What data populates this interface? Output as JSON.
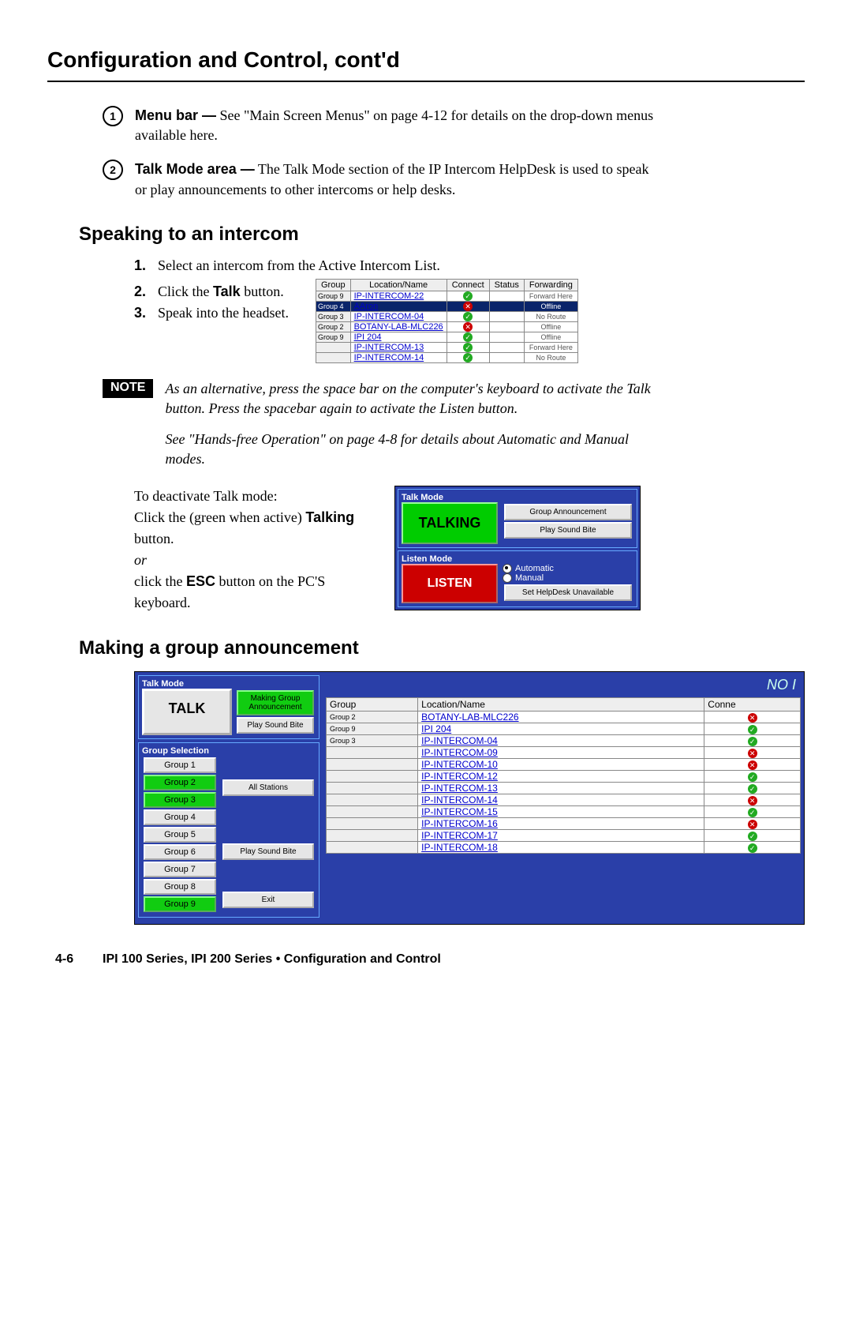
{
  "page_title": "Configuration and Control, cont'd",
  "items": [
    {
      "num": "1",
      "bold": "Menu bar —",
      "text": " See \"Main Screen Menus\" on page 4-12 for details on the drop-down menus available here."
    },
    {
      "num": "2",
      "bold": "Talk Mode area —",
      "text": " The Talk Mode section of the IP Intercom HelpDesk is used to speak or play announcements to other intercoms or help desks."
    }
  ],
  "h2_1": "Speaking to an intercom",
  "steps_top": {
    "num": "1.",
    "text": "Select an intercom from the Active Intercom List."
  },
  "steps_side": [
    {
      "num": "2.",
      "pre": "Click the ",
      "bold": "Talk",
      "post": " button."
    },
    {
      "num": "3.",
      "pre": "Speak into the headset.",
      "bold": "",
      "post": ""
    }
  ],
  "intercom_headers": [
    "Group",
    "Location/Name",
    "Connect",
    "Status",
    "Forwarding"
  ],
  "intercom_rows": [
    {
      "g": "Group 9",
      "name": "IP-INTERCOM-22",
      "ok": true,
      "fwd": "Forward Here",
      "sel": false
    },
    {
      "g": "Group 4",
      "name": "AAron",
      "ok": false,
      "fwd": "Offline",
      "sel": true
    },
    {
      "g": "Group 3",
      "name": "IP-INTERCOM-04",
      "ok": true,
      "fwd": "No Route",
      "sel": false
    },
    {
      "g": "Group 2",
      "name": "BOTANY-LAB-MLC226",
      "ok": false,
      "fwd": "Offline",
      "sel": false
    },
    {
      "g": "Group 9",
      "name": "IPI 204",
      "ok": true,
      "fwd": "Offline",
      "sel": false
    },
    {
      "g": "",
      "name": "IP-INTERCOM-13",
      "ok": true,
      "fwd": "Forward Here",
      "sel": false
    },
    {
      "g": "",
      "name": "IP-INTERCOM-14",
      "ok": true,
      "fwd": "No Route",
      "sel": false
    }
  ],
  "note_label": "NOTE",
  "note_p1": "As an alternative, press the space bar on the computer's keyboard to activate the Talk button.  Press the spacebar again to activate the Listen button.",
  "note_p2": "See \"Hands-free Operation\" on page 4-8 for details about Automatic and Manual modes.",
  "deact_1": "To deactivate Talk mode:",
  "deact_2a": "Click the (green when active) ",
  "deact_2b": "Talking",
  "deact_2c": " button.",
  "deact_or": "or",
  "deact_3a": "click the ",
  "deact_3b": "ESC",
  "deact_3c": " button on the PC'S keyboard.",
  "talk_panel": {
    "talk_mode": "Talk Mode",
    "talking": "TALKING",
    "group_ann": "Group Announcement",
    "play_sound": "Play Sound Bite",
    "listen_mode": "Listen Mode",
    "listen": "LISTEN",
    "automatic": "Automatic",
    "manual": "Manual",
    "set_help": "Set HelpDesk Unavailable"
  },
  "h2_2": "Making a group announcement",
  "ga_left": {
    "talk_mode": "Talk Mode",
    "talk": "TALK",
    "making": "Making Group Announcement",
    "play_sound": "Play Sound Bite",
    "group_selection": "Group Selection",
    "groups": [
      {
        "label": "Group 1",
        "active": false
      },
      {
        "label": "Group 2",
        "active": true
      },
      {
        "label": "Group 3",
        "active": true
      },
      {
        "label": "Group 4",
        "active": false
      },
      {
        "label": "Group 5",
        "active": false
      },
      {
        "label": "Group 6",
        "active": false
      },
      {
        "label": "Group 7",
        "active": false
      },
      {
        "label": "Group 8",
        "active": false
      },
      {
        "label": "Group 9",
        "active": true
      }
    ],
    "all_stations": "All Stations",
    "play_sound2": "Play Sound Bite",
    "exit": "Exit"
  },
  "ga_right": {
    "no": "NO I",
    "headers": [
      "Group",
      "Location/Name",
      "Conne"
    ],
    "rows": [
      {
        "g": "Group 2",
        "name": "BOTANY-LAB-MLC226",
        "ok": false
      },
      {
        "g": "Group 9",
        "name": "IPI 204",
        "ok": true
      },
      {
        "g": "Group 3",
        "name": "IP-INTERCOM-04",
        "ok": true
      },
      {
        "g": "",
        "name": "IP-INTERCOM-09",
        "ok": false
      },
      {
        "g": "",
        "name": "IP-INTERCOM-10",
        "ok": false
      },
      {
        "g": "",
        "name": "IP-INTERCOM-12",
        "ok": true
      },
      {
        "g": "",
        "name": "IP-INTERCOM-13",
        "ok": true
      },
      {
        "g": "",
        "name": "IP-INTERCOM-14",
        "ok": false
      },
      {
        "g": "",
        "name": "IP-INTERCOM-15",
        "ok": true
      },
      {
        "g": "",
        "name": "IP-INTERCOM-16",
        "ok": false
      },
      {
        "g": "",
        "name": "IP-INTERCOM-17",
        "ok": true
      },
      {
        "g": "",
        "name": "IP-INTERCOM-18",
        "ok": true
      }
    ]
  },
  "footer_page": "4-6",
  "footer_text": "IPI 100 Series, IPI 200 Series • Configuration and Control"
}
